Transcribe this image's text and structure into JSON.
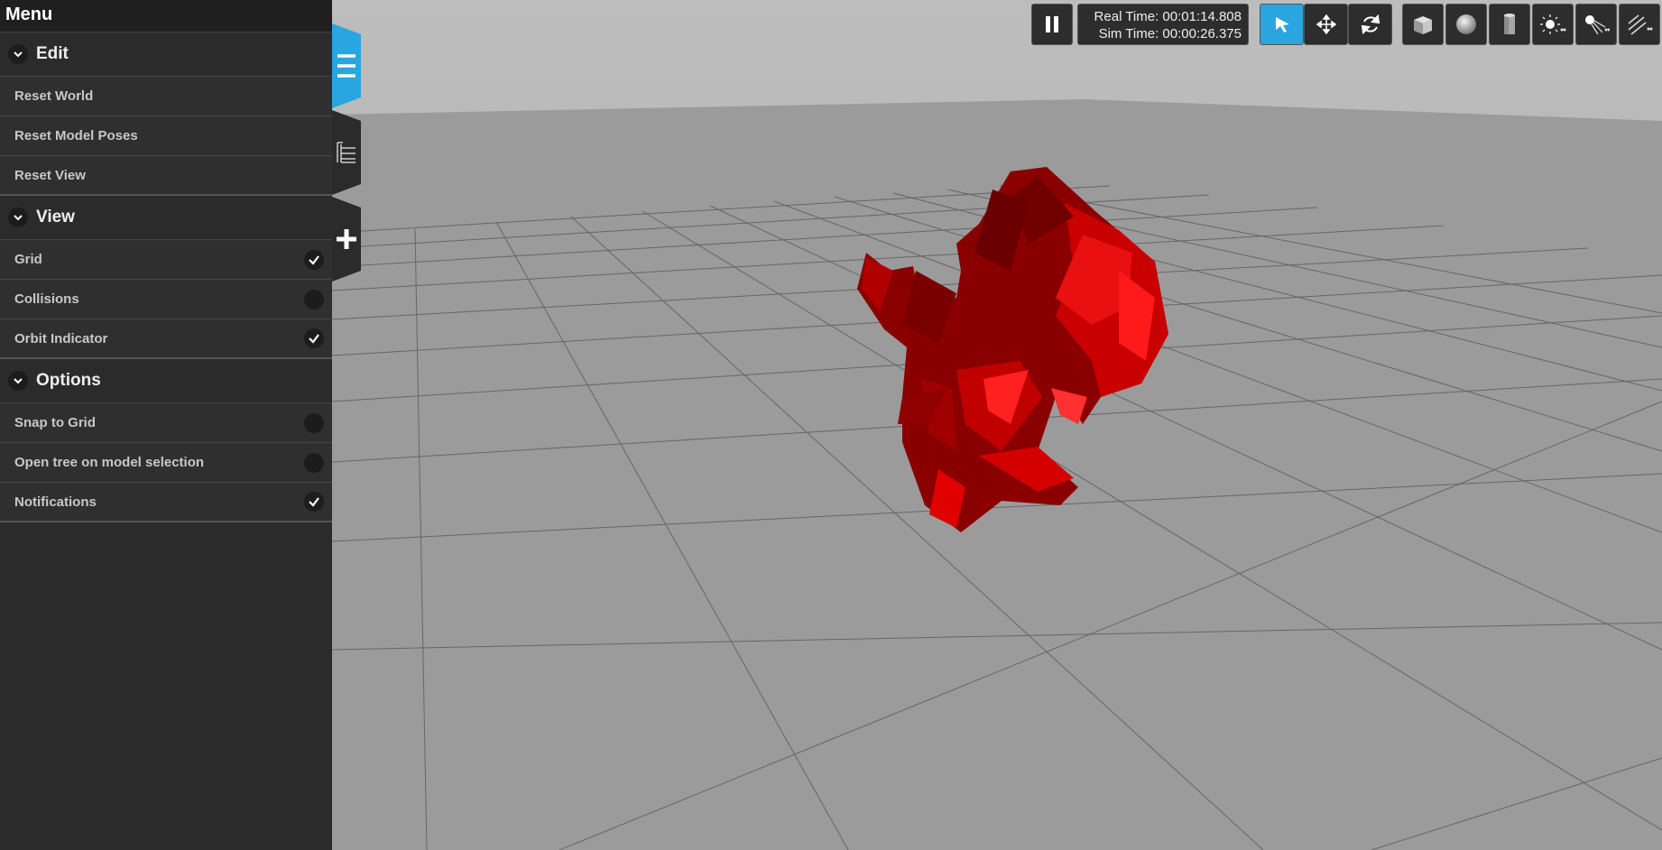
{
  "menu": {
    "title": "Menu"
  },
  "sections": {
    "edit": {
      "title": "Edit",
      "items": [
        "Reset World",
        "Reset Model Poses",
        "Reset View"
      ]
    },
    "view": {
      "title": "View",
      "items": [
        {
          "label": "Grid",
          "checked": true
        },
        {
          "label": "Collisions",
          "checked": false
        },
        {
          "label": "Orbit Indicator",
          "checked": true
        }
      ]
    },
    "options": {
      "title": "Options",
      "items": [
        {
          "label": "Snap to Grid",
          "checked": false
        },
        {
          "label": "Open tree on model selection",
          "checked": false
        },
        {
          "label": "Notifications",
          "checked": true
        }
      ]
    }
  },
  "sidetabs": [
    {
      "icon": "menu-icon",
      "active": true
    },
    {
      "icon": "tree-icon",
      "active": false
    },
    {
      "icon": "insert-plus-icon",
      "active": false
    }
  ],
  "toolbar": {
    "pause_icon": "pause-icon",
    "real_time_label": "Real Time: 00:01:14.808",
    "sim_time_label": "Sim Time: 00:00:26.375",
    "modes": [
      {
        "icon": "select-arrow-icon",
        "active": true
      },
      {
        "icon": "translate-icon",
        "active": false
      },
      {
        "icon": "rotate-icon",
        "active": false
      }
    ],
    "shapes": [
      "box-icon",
      "sphere-icon",
      "cylinder-icon",
      "point-light-icon",
      "spot-light-icon",
      "directional-light-icon"
    ]
  },
  "colors": {
    "accent": "#29a6df",
    "panel": "#2b2b2b",
    "model": "#d00000",
    "ground": "#9a9a9a",
    "sky": "#b5b5b5"
  }
}
